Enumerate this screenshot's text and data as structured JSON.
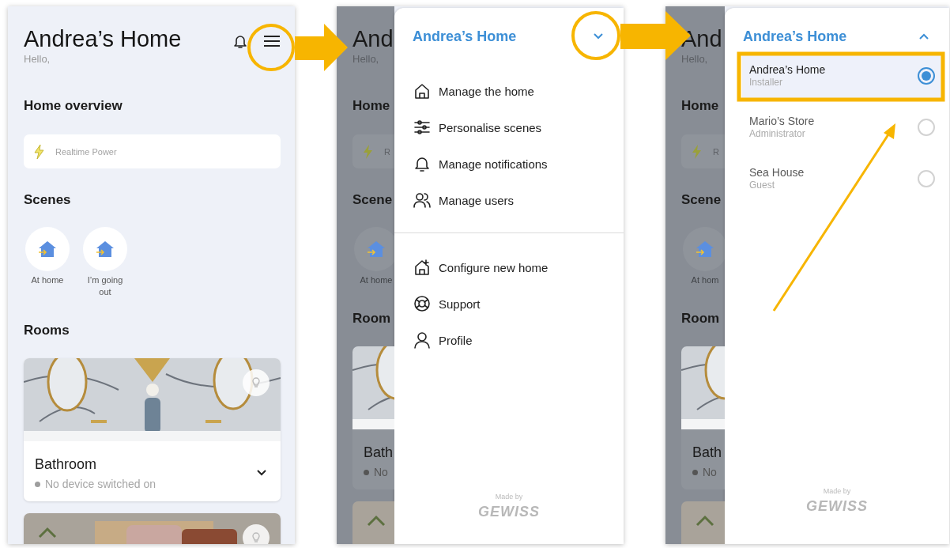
{
  "screens": [
    {
      "kind": "home",
      "title": "Andrea’s Home",
      "greeting": "Hello,",
      "overview": {
        "heading": "Home overview",
        "card_label": "Realtime Power"
      },
      "scenes": {
        "heading": "Scenes",
        "items": [
          {
            "label": "At home"
          },
          {
            "label": "I’m going out"
          }
        ]
      },
      "rooms": {
        "heading": "Rooms",
        "items": [
          {
            "kind": "room",
            "name": "Bathroom",
            "status": "No device switched on",
            "expanded": false
          },
          {
            "kind": "picture"
          }
        ]
      }
    },
    {
      "kind": "drawer",
      "behind": {
        "title": "And",
        "greeting": "Hello,",
        "overview": "Home",
        "card_label": "R",
        "scenes": "Scene",
        "scene_label": "At home",
        "rooms": "Room",
        "room": "Bath",
        "status": "No"
      },
      "drawer": {
        "title": "Andrea’s Home",
        "expanded": false,
        "groups": [
          [
            {
              "label": "Manage the home"
            },
            {
              "label": "Personalise scenes"
            },
            {
              "label": "Manage notifications"
            },
            {
              "label": "Manage users"
            }
          ],
          [
            {
              "label": "Configure new home"
            },
            {
              "label": "Support"
            },
            {
              "label": "Profile"
            }
          ]
        ],
        "made_by": "Made by",
        "brand": "GEWISS"
      }
    },
    {
      "kind": "drawer",
      "behind": {
        "title": "And",
        "greeting": "Hello,",
        "overview": "Home",
        "card_label": "R",
        "scenes": "Scene",
        "scene_label": "At hom",
        "rooms": "Room",
        "room": "Bath",
        "status": "No"
      },
      "drawer": {
        "title": "Andrea’s Home",
        "expanded": true,
        "homes": [
          {
            "name": "Andrea’s Home",
            "role": "Installer",
            "selected": true
          },
          {
            "name": "Mario’s Store",
            "role": "Administrator",
            "selected": false
          },
          {
            "name": "Sea House",
            "role": "Guest",
            "selected": false
          }
        ],
        "made_by": "Made by",
        "brand": "GEWISS"
      }
    }
  ]
}
